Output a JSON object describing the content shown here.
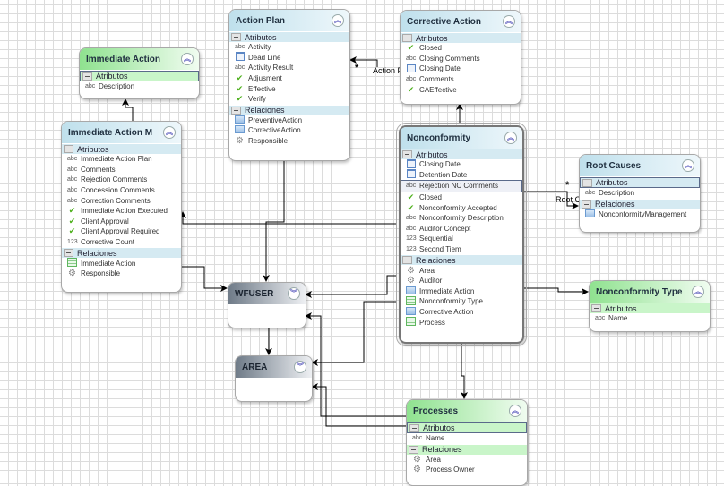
{
  "entities": [
    {
      "title": "Immediate Action",
      "theme": "green",
      "sections": [
        {
          "label": "Atributos",
          "selected": true,
          "items": [
            {
              "icon": "abc",
              "label": "Description"
            }
          ]
        }
      ]
    },
    {
      "title": "Action Plan",
      "theme": "blue",
      "sections": [
        {
          "label": "Atributos",
          "items": [
            {
              "icon": "abc",
              "label": "Activity"
            },
            {
              "icon": "calendar",
              "label": "Dead Line"
            },
            {
              "icon": "abc",
              "label": "Activity Result"
            },
            {
              "icon": "check",
              "label": "Adjusment"
            },
            {
              "icon": "check",
              "label": "Effective"
            },
            {
              "icon": "check",
              "label": "Verify"
            }
          ]
        },
        {
          "label": "Relaciones",
          "items": [
            {
              "icon": "relation",
              "label": "PreventiveAction"
            },
            {
              "icon": "relation",
              "label": "CorrectiveAction"
            },
            {
              "icon": "gear",
              "label": "Responsible"
            }
          ]
        }
      ]
    },
    {
      "title": "Corrective Action",
      "theme": "blue",
      "sections": [
        {
          "label": "Atributos",
          "items": [
            {
              "icon": "check",
              "label": "Closed"
            },
            {
              "icon": "abc",
              "label": "Closing Comments"
            },
            {
              "icon": "calendar",
              "label": "Closing Date"
            },
            {
              "icon": "abc",
              "label": "Comments"
            },
            {
              "icon": "check",
              "label": "CAEffective"
            }
          ]
        }
      ]
    },
    {
      "title": "Immediate Action M",
      "theme": "blue",
      "sections": [
        {
          "label": "Atributos",
          "items": [
            {
              "icon": "abc",
              "label": "Immediate Action Plan"
            },
            {
              "icon": "abc",
              "label": "Comments"
            },
            {
              "icon": "abc",
              "label": "Rejection Comments"
            },
            {
              "icon": "abc",
              "label": "Concession Comments"
            },
            {
              "icon": "abc",
              "label": "Correction Comments"
            },
            {
              "icon": "check",
              "label": "Immediate Action Executed"
            },
            {
              "icon": "check",
              "label": "Client Approval"
            },
            {
              "icon": "check",
              "label": "Client Approval Required"
            },
            {
              "icon": "123",
              "label": "Corrective Count"
            }
          ]
        },
        {
          "label": "Relaciones",
          "items": [
            {
              "icon": "table",
              "label": "Immediate Action"
            },
            {
              "icon": "gear",
              "label": "Responsible"
            }
          ]
        }
      ]
    },
    {
      "title": "Nonconformity",
      "theme": "blue",
      "double": true,
      "sections": [
        {
          "label": "Atributos",
          "items": [
            {
              "icon": "calendar",
              "label": "Closing Date"
            },
            {
              "icon": "calendar",
              "label": "Detention Date"
            },
            {
              "icon": "abc",
              "label": "Rejection NC Comments",
              "selected": true
            },
            {
              "icon": "check",
              "label": "Closed"
            },
            {
              "icon": "check",
              "label": "Nonconformity Accepted"
            },
            {
              "icon": "abc",
              "label": "Nonconformity Description"
            },
            {
              "icon": "abc",
              "label": "Auditor Concept"
            },
            {
              "icon": "123",
              "label": "Sequential"
            },
            {
              "icon": "123",
              "label": "Second Tiem"
            }
          ]
        },
        {
          "label": "Relaciones",
          "items": [
            {
              "icon": "gear",
              "label": "Area"
            },
            {
              "icon": "gear",
              "label": "Auditor"
            },
            {
              "icon": "relation",
              "label": "Immediate Action"
            },
            {
              "icon": "table",
              "label": "Nonconformity Type"
            },
            {
              "icon": "relation",
              "label": "Corrective Action"
            },
            {
              "icon": "table",
              "label": "Process"
            }
          ]
        }
      ]
    },
    {
      "title": "Root Causes",
      "theme": "blue",
      "sections": [
        {
          "label": "Atributos",
          "selected": true,
          "items": [
            {
              "icon": "abc",
              "label": "Description"
            }
          ]
        },
        {
          "label": "Relaciones",
          "items": [
            {
              "icon": "relation",
              "label": "NonconformityManagement"
            }
          ]
        }
      ]
    },
    {
      "title": "Nonconformity Type",
      "theme": "green",
      "sections": [
        {
          "label": "Atributos",
          "items": [
            {
              "icon": "abc",
              "label": "Name"
            }
          ]
        }
      ]
    },
    {
      "title": "WFUSER",
      "theme": "gray",
      "collapsed": true,
      "sections": []
    },
    {
      "title": "AREA",
      "theme": "gray",
      "collapsed": true,
      "sections": []
    },
    {
      "title": "Processes",
      "theme": "green",
      "sections": [
        {
          "label": "Atributos",
          "selected": true,
          "items": [
            {
              "icon": "abc",
              "label": "Name"
            }
          ]
        },
        {
          "label": "Relaciones",
          "items": [
            {
              "icon": "gear",
              "label": "Area"
            },
            {
              "icon": "gear",
              "label": "Process Owner"
            }
          ]
        }
      ]
    }
  ],
  "connector_labels": {
    "action_plan": "Action Plan",
    "root_causes": "Root C",
    "multiplicity": "*"
  }
}
